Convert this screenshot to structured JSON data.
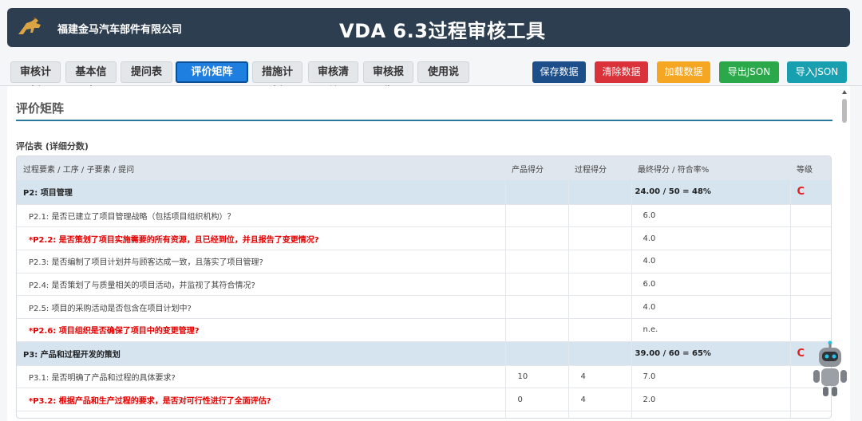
{
  "header": {
    "company": "福建金马汽车部件有限公司",
    "title": "VDA 6.3过程审核工具",
    "logo_icon": "horse-logo-icon"
  },
  "tabs": [
    {
      "label": "审核计划",
      "active": false
    },
    {
      "label": "基本信息",
      "active": false
    },
    {
      "label": "提问表",
      "active": false
    },
    {
      "label": "评价矩阵",
      "active": true
    },
    {
      "label": "措施计划",
      "active": false
    },
    {
      "label": "审核清单",
      "active": false
    },
    {
      "label": "审核报告",
      "active": false
    },
    {
      "label": "使用说明",
      "active": false
    }
  ],
  "actions": [
    {
      "label": "保存数据",
      "color": "#1c4f8a"
    },
    {
      "label": "清除数据",
      "color": "#d9323a"
    },
    {
      "label": "加载数据",
      "color": "#f5a623"
    },
    {
      "label": "导出JSON",
      "color": "#2aa84a"
    },
    {
      "label": "导入JSON",
      "color": "#19a0b0"
    }
  ],
  "section": {
    "title": "评价矩阵",
    "subtitle": "评估表 (详细分数)"
  },
  "table": {
    "headers": [
      "过程要素 / 工序 / 子要素 / 提问",
      "产品得分",
      "过程得分",
      "最终得分 / 符合率%",
      "等级"
    ],
    "rows": [
      {
        "type": "group",
        "label": "P2: 项目管理",
        "product": "",
        "process": "",
        "final": "24.00 / 50 = 48%",
        "grade": "C"
      },
      {
        "type": "question",
        "label": "P2.1: 是否已建立了项目管理战略（包括项目组织机构）？",
        "product": "",
        "process": "",
        "final": "6.0",
        "grade": ""
      },
      {
        "type": "special",
        "label": "*P2.2: 是否策划了项目实施需要的所有资源，且已经到位，并且报告了变更情况?",
        "product": "",
        "process": "",
        "final": "4.0",
        "grade": ""
      },
      {
        "type": "question",
        "label": "P2.3: 是否编制了项目计划并与顾客达成一致，且落实了项目管理?",
        "product": "",
        "process": "",
        "final": "4.0",
        "grade": ""
      },
      {
        "type": "question",
        "label": "P2.4: 是否策划了与质量相关的项目活动，并监视了其符合情况?",
        "product": "",
        "process": "",
        "final": "6.0",
        "grade": ""
      },
      {
        "type": "question",
        "label": "P2.5: 项目的采购活动是否包含在项目计划中?",
        "product": "",
        "process": "",
        "final": "4.0",
        "grade": ""
      },
      {
        "type": "special",
        "label": "*P2.6: 项目组织是否确保了项目中的变更管理?",
        "product": "",
        "process": "",
        "final": "n.e.",
        "grade": ""
      },
      {
        "type": "group",
        "label": "P3: 产品和过程开发的策划",
        "product": "",
        "process": "",
        "final": "39.00 / 60 = 65%",
        "grade": "C"
      },
      {
        "type": "question",
        "label": "P3.1: 是否明确了产品和过程的具体要求?",
        "product": "10",
        "process": "4",
        "final": "7.0",
        "grade": ""
      },
      {
        "type": "special",
        "label": "*P3.2: 根据产品和生产过程的要求，是否对可行性进行了全面评估?",
        "product": "0",
        "process": "4",
        "final": "2.0",
        "grade": ""
      },
      {
        "type": "question",
        "label": "",
        "product": "",
        "process": "",
        "final": "",
        "grade": ""
      }
    ]
  },
  "assistant": {
    "icon": "robot-assistant-icon"
  }
}
